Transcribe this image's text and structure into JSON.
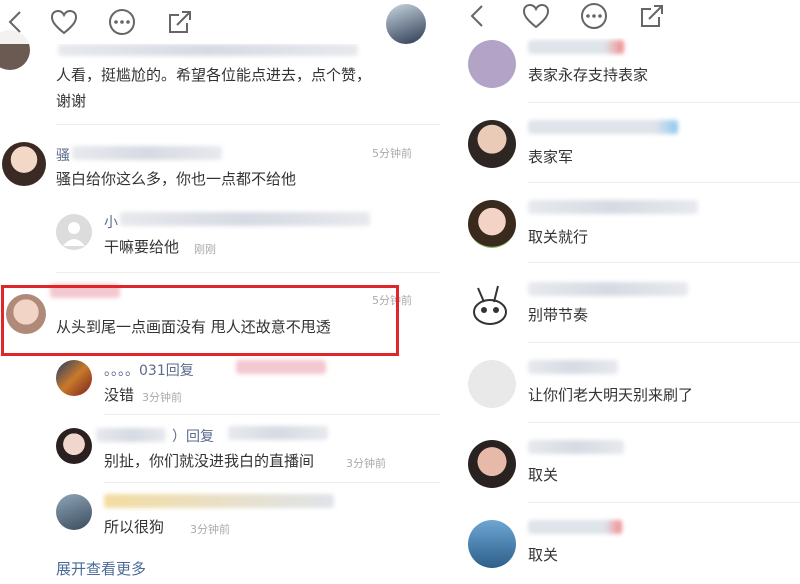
{
  "left_screen": {
    "top_text": {
      "line1": "人看，挺尴尬的。希望各位能点进去，点个赞，",
      "line2": "谢谢"
    },
    "comments": [
      {
        "name": "骚",
        "time": "5分钟前",
        "text": "骚白给你这么多，你也一点都不给他"
      },
      {
        "name": "小",
        "time": "刚刚",
        "text": "干嘛要给他"
      },
      {
        "name": "",
        "time": "5分钟前",
        "text": "从头到尾一点画面没有 甩人还故意不甩透"
      },
      {
        "name": "。。。。031回复",
        "time": "3分钟前",
        "text": "没错"
      },
      {
        "name": "）回复",
        "time": "3分钟前",
        "text": "别扯，你们就没进我白的直播间"
      },
      {
        "name": "",
        "time": "3分钟前",
        "text": "所以很狗"
      }
    ],
    "expand_more": "展开查看更多",
    "highlight_color": "#e0262b"
  },
  "right_screen": {
    "comments": [
      {
        "text": "表家永存支持表家"
      },
      {
        "text": "表家军"
      },
      {
        "text": "取关就行"
      },
      {
        "text": "别带节奏"
      },
      {
        "text": "让你们老大明天别来刷了"
      },
      {
        "text": "取关"
      },
      {
        "text": "取关"
      }
    ]
  },
  "icons": [
    "back-icon",
    "heart-icon",
    "more-icon",
    "share-icon"
  ]
}
